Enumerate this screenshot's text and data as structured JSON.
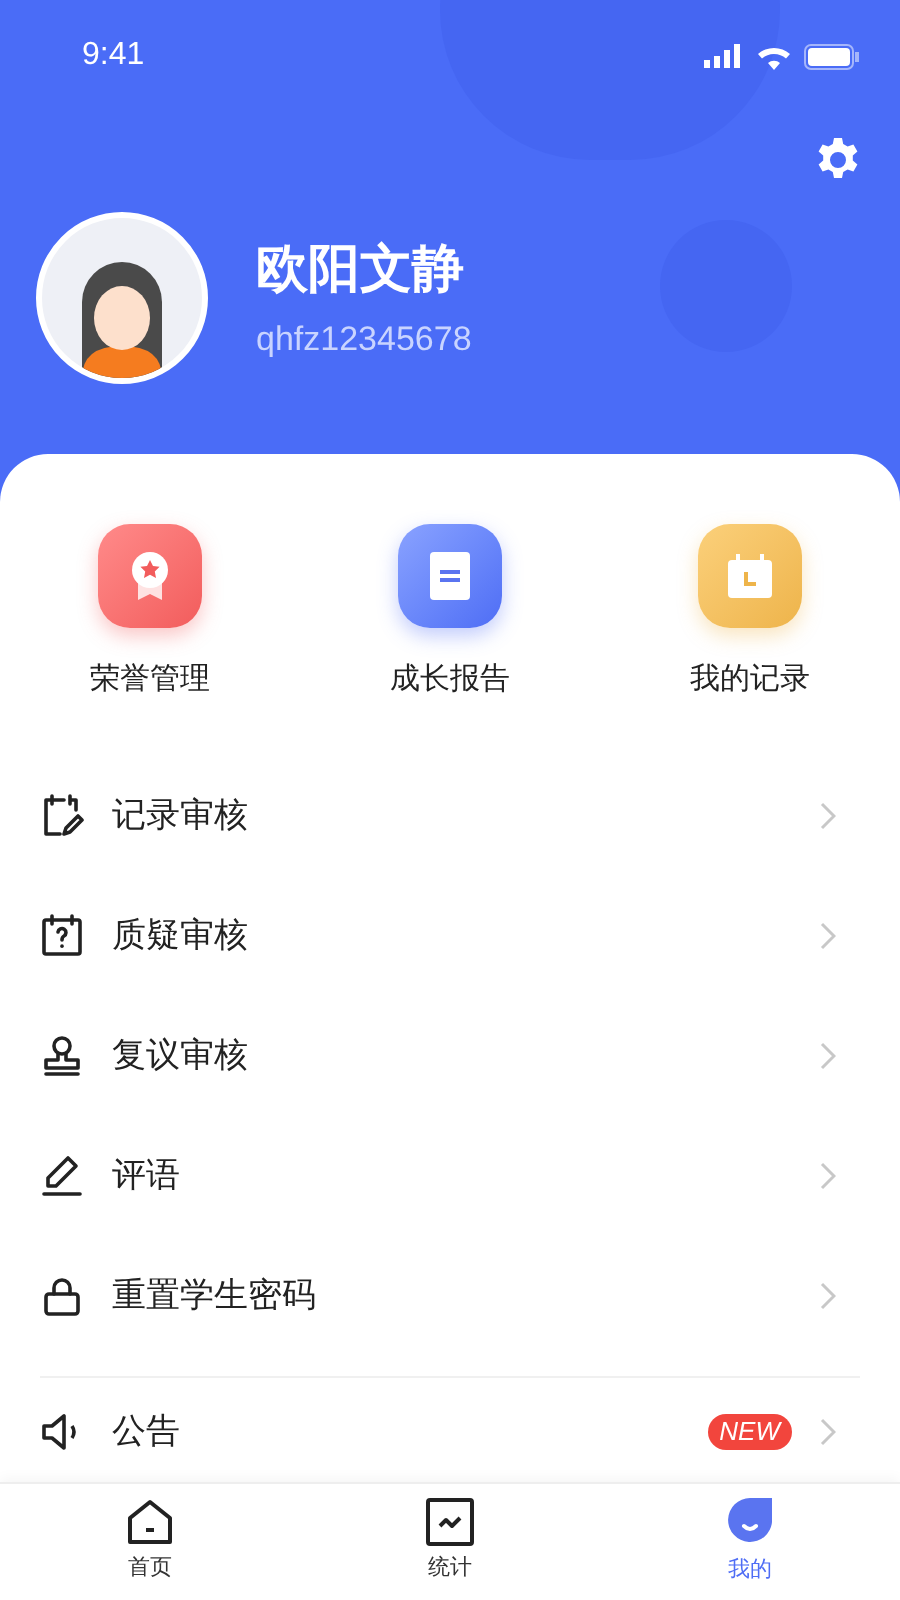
{
  "status_bar": {
    "time": "9:41"
  },
  "profile": {
    "name": "欧阳文静",
    "username": "qhfz12345678"
  },
  "quick_actions": [
    {
      "kind": "honor",
      "label": "荣誉管理"
    },
    {
      "kind": "report",
      "label": "成长报告"
    },
    {
      "kind": "record",
      "label": "我的记录"
    }
  ],
  "menu": [
    {
      "kind": "record-review",
      "label": "记录审核"
    },
    {
      "kind": "question",
      "label": "质疑审核"
    },
    {
      "kind": "stamp",
      "label": "复议审核"
    },
    {
      "kind": "comment",
      "label": "评语"
    },
    {
      "kind": "lock",
      "label": "重置学生密码"
    }
  ],
  "announcement": {
    "label": "公告",
    "badge": "NEW"
  },
  "tabs": [
    {
      "kind": "home",
      "label": "首页",
      "selected": false
    },
    {
      "kind": "stats",
      "label": "统计",
      "selected": false
    },
    {
      "kind": "me",
      "label": "我的",
      "selected": true
    }
  ]
}
